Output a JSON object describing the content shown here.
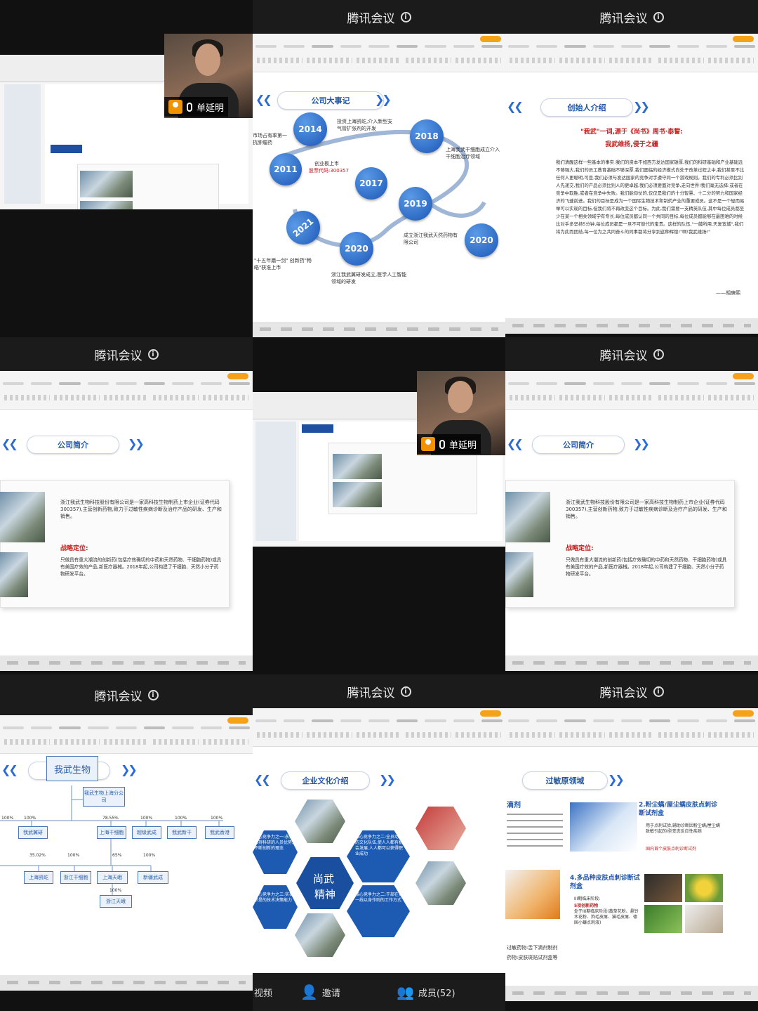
{
  "app_title": "腾讯会议",
  "presenter": "单延明",
  "slides": {
    "milestones": {
      "title": "公司大事记",
      "years": [
        "2014",
        "2018",
        "2011",
        "2017",
        "2019",
        "2021",
        "2020",
        "2020"
      ],
      "notes": [
        "投资上海凯屹,介入新型支气管扩张剂的开发",
        "上海我武干细胞成立介入干细胞治疗领域",
        "市场占有率第一抗肿瘤药",
        "创业板上市",
        "股票代码:300357",
        "成立浙江我武天然药物有限公司",
        "\"十五年磨一剑\" 创新药\"畅皓\"获准上市",
        "浙江我武翼研发成立,医学人工智能领域的研发"
      ]
    },
    "founder": {
      "title": "创始人介绍",
      "heading1": "\"我武\"一词,源于《尚书》周书·泰誓:",
      "heading2": "我武维扬,侵于之疆",
      "body": "我们清醒这样一些基本的事实:我们的资本不如西方发达国家雄厚,我们的科研基础和产业基础远不够强大,我们的员工教育基础不够深厚,我们面临的经济模式尚处于改革过程之中,我们甚至不比任何人更聪明,可是,我们必须与发达国家的竞争对手遵守同一个游戏规则。我们的专利必须比别人先递交,我们的产品必须比别人的更卓越,我们必须要面对竞争,走向世界!我们毫无选择:或者在竞争中取胜,或者在竞争中失败。我们能仰仗的,仅仅是我们的十分智慧、十二分的努力和国家经济的飞速前进。我们的目标是成为一个国际生物技术和制药产业的重要成员。这不是一个轻而易举可以实现的目标,但我们将不再改变这个目标。为此,我们需要一支精英队伍,其中每位成员都至少在某一个相关领域学有专长,每位成员都认同一个共同的目标,每位成员都能够在最困难的时候比对手多坚持5分钟,每位成员都是一旦不可替代的宝贵。这样的队伍,\"一鼓所用,天复宽城\",我们将为此而团结,每一位为之共同奋斗的同事都将分享到这种辉煌!\"啊!我武维扬!\"",
      "signature": "——胡庚熙"
    },
    "company_intro": {
      "title": "公司简介",
      "p1": "浙江我武生物科技股份有限公司是一家高科技生物制药上市企业(证券代码300357),主营创新药物,致力于过敏性疾病诊断及治疗产品的研发、生产和销售。",
      "strategy_label": "战略定位:",
      "p2": "只做具有重大潮流的创新药(包括疗效确切的中药和天然药物、干细胞药物)或具有美国疗效的产品,新医疗器械。2018年起,公司构建了干细胞、天然小分子药物研发平台。"
    },
    "org": {
      "title": "公司组织架构",
      "root": "我武生物",
      "branch": "我武生物上海分公司",
      "level1_pcts": [
        "100%",
        "100%",
        "78.55%",
        "100%",
        "100%",
        "100%"
      ],
      "level1": [
        "我武翼研",
        "上海干细胞",
        "超级武成",
        "我武新干",
        "我武香港"
      ],
      "level2_pcts": [
        "35.02%",
        "100%",
        "65%",
        "100%"
      ],
      "level2": [
        "上海凯屹",
        "浙江干细胞",
        "上海天峨",
        "新疆武成"
      ],
      "level3_pct": "100%",
      "level3": "浙江天峨"
    },
    "culture": {
      "title": "企业文化介绍",
      "center": [
        "尚武",
        "精神"
      ],
      "items": [
        "核心竞争力之一:永远保持科研的人员优势,不断创新的理念",
        "核心竞争力之二:全员动员的文化队伍,使人人都有机会发展,人人都可以获得职业成功",
        "核心竞争力之三:实事求是的技术决策能力",
        "核心竞争力之二:干部在第一线以身作则的工作方式"
      ]
    },
    "allergen": {
      "title": "过敏原领域",
      "heading_left": "滴剂",
      "item2": "2.粉尘螨/屋尘螨皮肤点刺诊断试剂盒",
      "item2_desc": "用于点刺试验,辅助诊断因粉尘螨/屋尘螨致敏引起的I型变态反应性疾病",
      "item2_highlight": "国内首个皮肤点刺诊断试剂",
      "item4": "4.多品种皮肤点刺诊断试剂盒",
      "item4_desc": "III期临床阶段:",
      "item4_highlight": "5项创新药物",
      "item4_tail": "处于III期临床阶段(蒿草花粉、悬铃木花粉、狗毛皮屑、猫毛皮屑、德国小蠊点刺液)",
      "left_lines": [
        "过敏药物:舌下滴剂制剂",
        "药物:皮肤斑贴试剂盒等"
      ]
    }
  },
  "bottom_toolbar": {
    "video_label": "视频",
    "invite_label": "邀请",
    "members_label": "成员(52)"
  }
}
